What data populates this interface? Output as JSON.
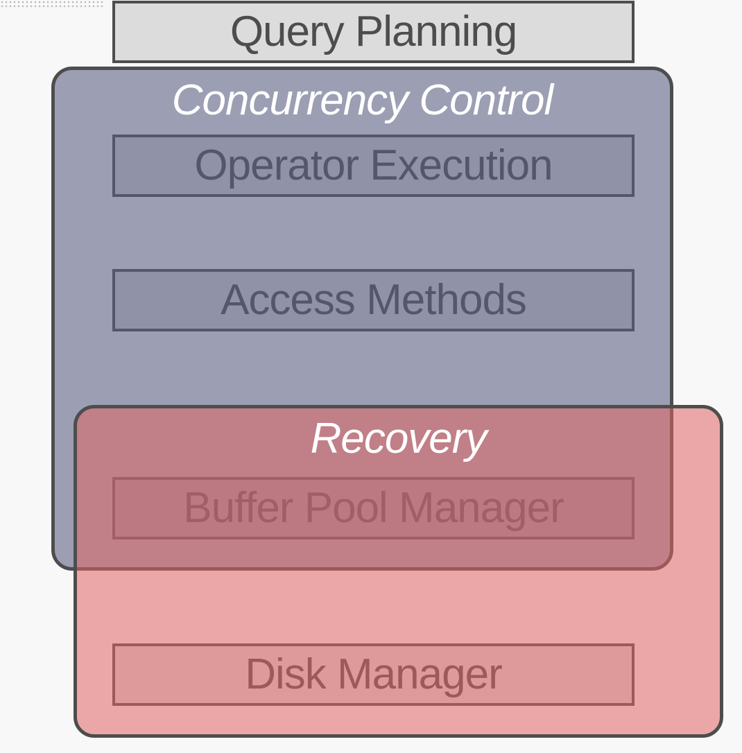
{
  "layers": {
    "query_planning": "Query Planning",
    "operator_execution": "Operator Execution",
    "access_methods": "Access Methods",
    "buffer_pool_manager": "Buffer Pool Manager",
    "disk_manager": "Disk Manager"
  },
  "panels": {
    "concurrency_control": "Concurrency Control",
    "recovery": "Recovery"
  },
  "colors": {
    "box_fill": "#dcdcdc",
    "border": "#4d4d4d",
    "concurrency_fill": "rgba(90,95,130,0.58)",
    "recovery_fill": "rgba(224,100,100,0.55)",
    "panel_text": "#ffffff"
  }
}
